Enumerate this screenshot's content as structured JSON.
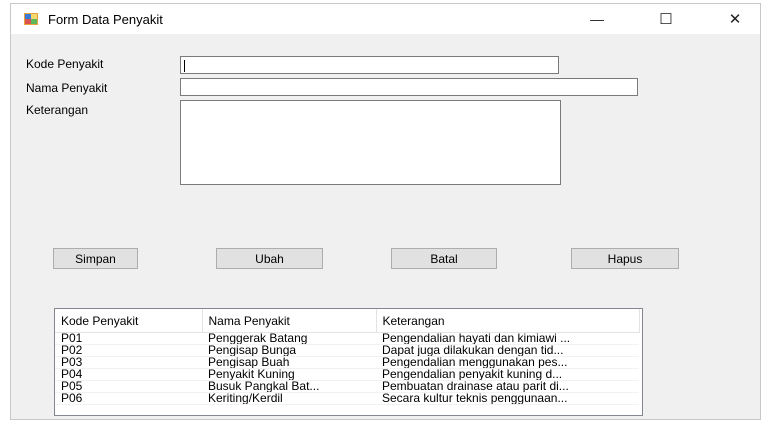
{
  "window": {
    "title": "Form Data Penyakit",
    "controls": {
      "minimize": "—",
      "maximize": "☐",
      "close": "✕"
    }
  },
  "form": {
    "kode_label": "Kode Penyakit",
    "nama_label": "Nama Penyakit",
    "keterangan_label": "Keterangan",
    "kode_value": "",
    "nama_value": "",
    "keterangan_value": ""
  },
  "buttons": {
    "simpan": "Simpan",
    "ubah": "Ubah",
    "batal": "Batal",
    "hapus": "Hapus"
  },
  "table": {
    "headers": [
      "Kode Penyakit",
      "Nama Penyakit",
      "Keterangan"
    ],
    "rows": [
      [
        "P01",
        "Penggerak Batang",
        "Pengendalian hayati dan kimiawi ..."
      ],
      [
        "P02",
        "Pengisap Bunga",
        "Dapat juga dilakukan dengan tid..."
      ],
      [
        "P03",
        "Pengisap Buah",
        "Pengendalian menggunakan pes..."
      ],
      [
        "P04",
        "Penyakit Kuning",
        "Pengendalian penyakit kuning d..."
      ],
      [
        "P05",
        "Busuk Pangkal Bat...",
        "Pembuatan drainase atau parit di..."
      ],
      [
        "P06",
        "Keriting/Kerdil",
        "Secara kultur teknis penggunaan..."
      ]
    ]
  }
}
